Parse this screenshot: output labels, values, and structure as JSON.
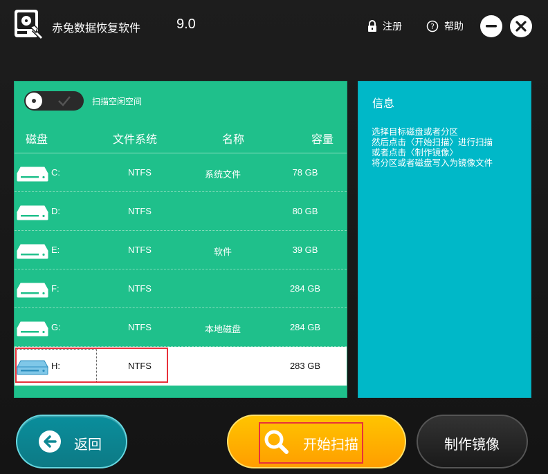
{
  "app": {
    "title": "赤兔数据恢复软件",
    "version": "9.0",
    "register_label": "注册",
    "help_label": "帮助"
  },
  "scan_free_space": {
    "label": "扫描空闲空间",
    "enabled": false
  },
  "disk_table": {
    "headers": {
      "disk": "磁盘",
      "fs": "文件系统",
      "name": "名称",
      "size": "容量"
    },
    "rows": [
      {
        "letter": "C:",
        "fs": "NTFS",
        "name": "系统文件",
        "size": "78 GB"
      },
      {
        "letter": "D:",
        "fs": "NTFS",
        "name": "",
        "size": "80 GB"
      },
      {
        "letter": "E:",
        "fs": "NTFS",
        "name": "软件",
        "size": "39 GB"
      },
      {
        "letter": "F:",
        "fs": "NTFS",
        "name": "",
        "size": "284 GB"
      },
      {
        "letter": "G:",
        "fs": "NTFS",
        "name": "本地磁盘",
        "size": "284 GB"
      },
      {
        "letter": "H:",
        "fs": "NTFS",
        "name": "",
        "size": "283 GB"
      }
    ],
    "selected_index": 5
  },
  "info": {
    "title": "信息",
    "lines": [
      "选择目标磁盘或者分区",
      "然后点击〈开始扫描〉进行扫描",
      "或者点击〈制作镜像〉",
      "将分区或者磁盘写入为镜像文件"
    ]
  },
  "buttons": {
    "back": "返回",
    "start_scan": "开始扫描",
    "make_image": "制作镜像"
  },
  "colors": {
    "disk_panel": "#1fc08b",
    "info_panel": "#00b8c8",
    "scan_button": "#ffb000",
    "back_button": "#0d8894",
    "highlight": "#e8313a"
  }
}
